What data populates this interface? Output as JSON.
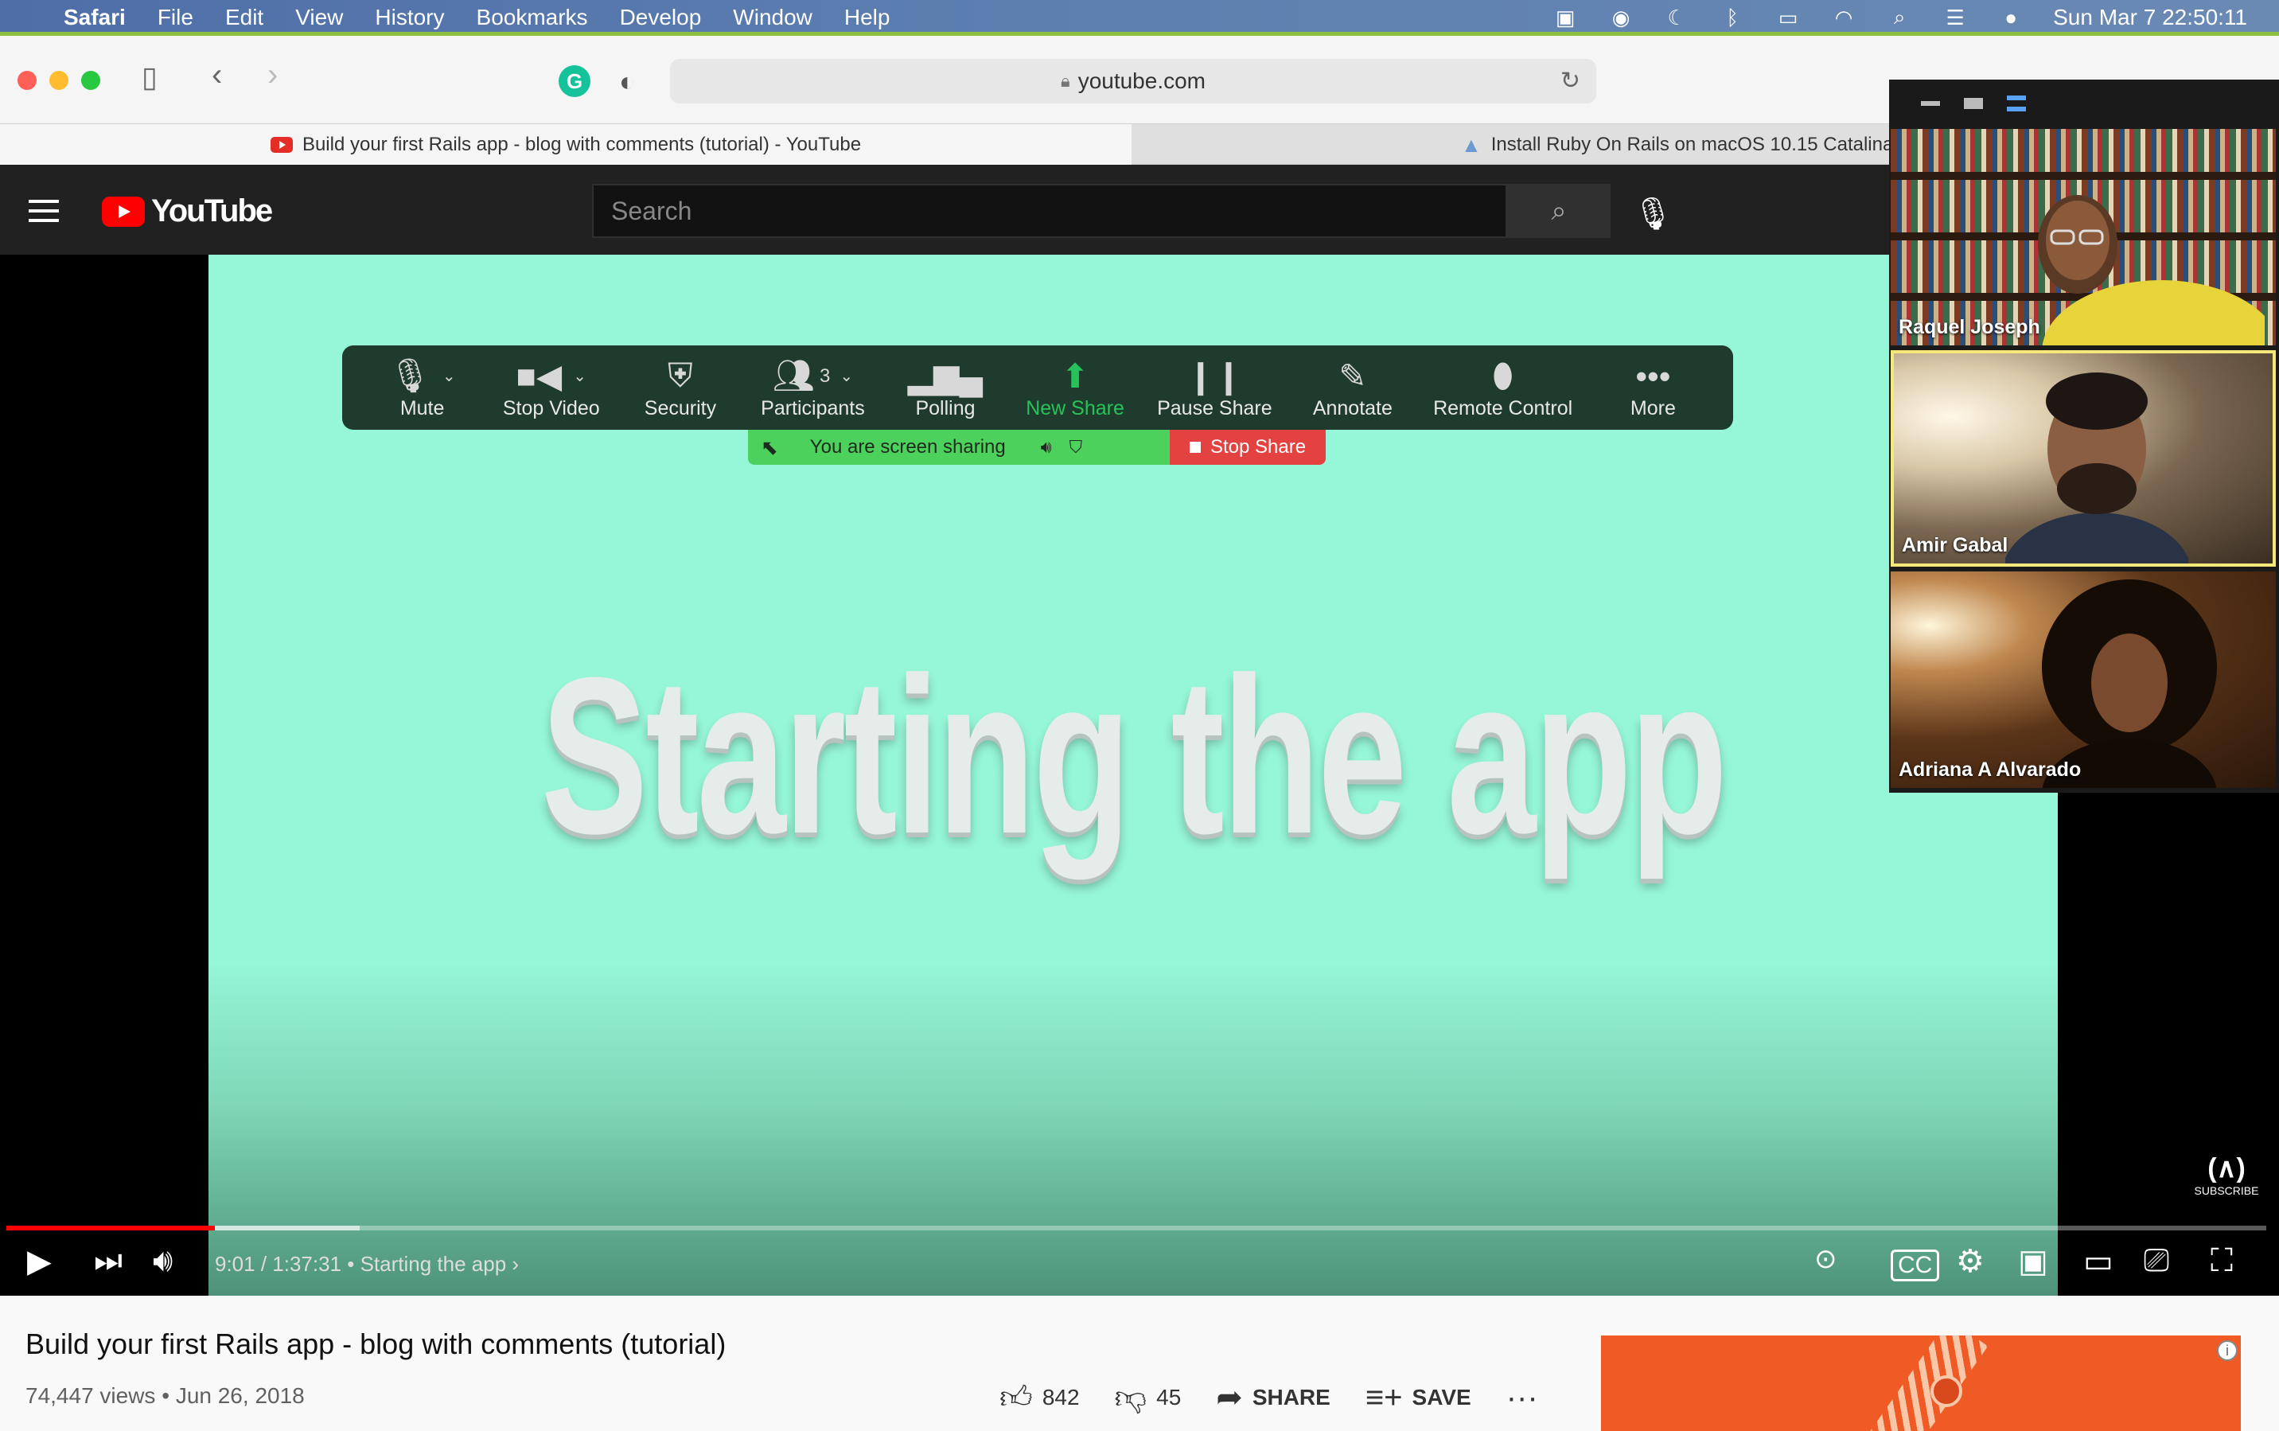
{
  "menubar": {
    "app": "Safari",
    "items": [
      "File",
      "Edit",
      "View",
      "History",
      "Bookmarks",
      "Develop",
      "Window",
      "Help"
    ],
    "datetime": "Sun Mar 7  22:50:11"
  },
  "browser": {
    "url": "youtube.com",
    "tabs": [
      {
        "title": "Build your first Rails app - blog with comments (tutorial) - YouTube"
      },
      {
        "title": "Install Ruby On Rails on macOS 10.15 Catalina |"
      }
    ]
  },
  "youtube": {
    "logo": "YouTube",
    "search_placeholder": "Search"
  },
  "video": {
    "overlay_title": "Starting the app",
    "time": "9:01 / 1:37:31",
    "chapter": "•  Starting the app",
    "progress_fraction": 0.0924,
    "buffered_fraction": 0.064,
    "subscribe_label": "SUBSCRIBE",
    "channel_mark": "(∧)"
  },
  "zoom": {
    "toolbar": [
      {
        "label": "Mute",
        "icon": "microphone-icon"
      },
      {
        "label": "Stop Video",
        "icon": "video-camera-icon"
      },
      {
        "label": "Security",
        "icon": "shield-icon"
      },
      {
        "label": "Participants",
        "icon": "participants-icon",
        "count": "3"
      },
      {
        "label": "Polling",
        "icon": "bar-chart-icon"
      },
      {
        "label": "New Share",
        "icon": "share-up-arrow-icon"
      },
      {
        "label": "Pause Share",
        "icon": "pause-icon"
      },
      {
        "label": "Annotate",
        "icon": "pencil-icon"
      },
      {
        "label": "Remote Control",
        "icon": "mouse-icon"
      },
      {
        "label": "More",
        "icon": "ellipsis-icon"
      }
    ],
    "sharing_status": "You are screen sharing",
    "stop_share": "Stop Share",
    "participants": [
      {
        "name": "Raquel Joseph"
      },
      {
        "name": "Amir Gabal"
      },
      {
        "name": "Adriana A Alvarado"
      }
    ]
  },
  "video_info": {
    "title": "Build your first Rails app - blog with comments (tutorial)",
    "views": "74,447 views",
    "date": "Jun 26, 2018",
    "likes": "842",
    "dislikes": "45",
    "share": "SHARE",
    "save": "SAVE"
  },
  "colors": {
    "video_bg": "#96f6d8",
    "zoom_toolbar": "#1f3b2d",
    "zoom_green": "#27c35a",
    "stop_share_red": "#e44141",
    "yt_red": "#ff0000"
  }
}
